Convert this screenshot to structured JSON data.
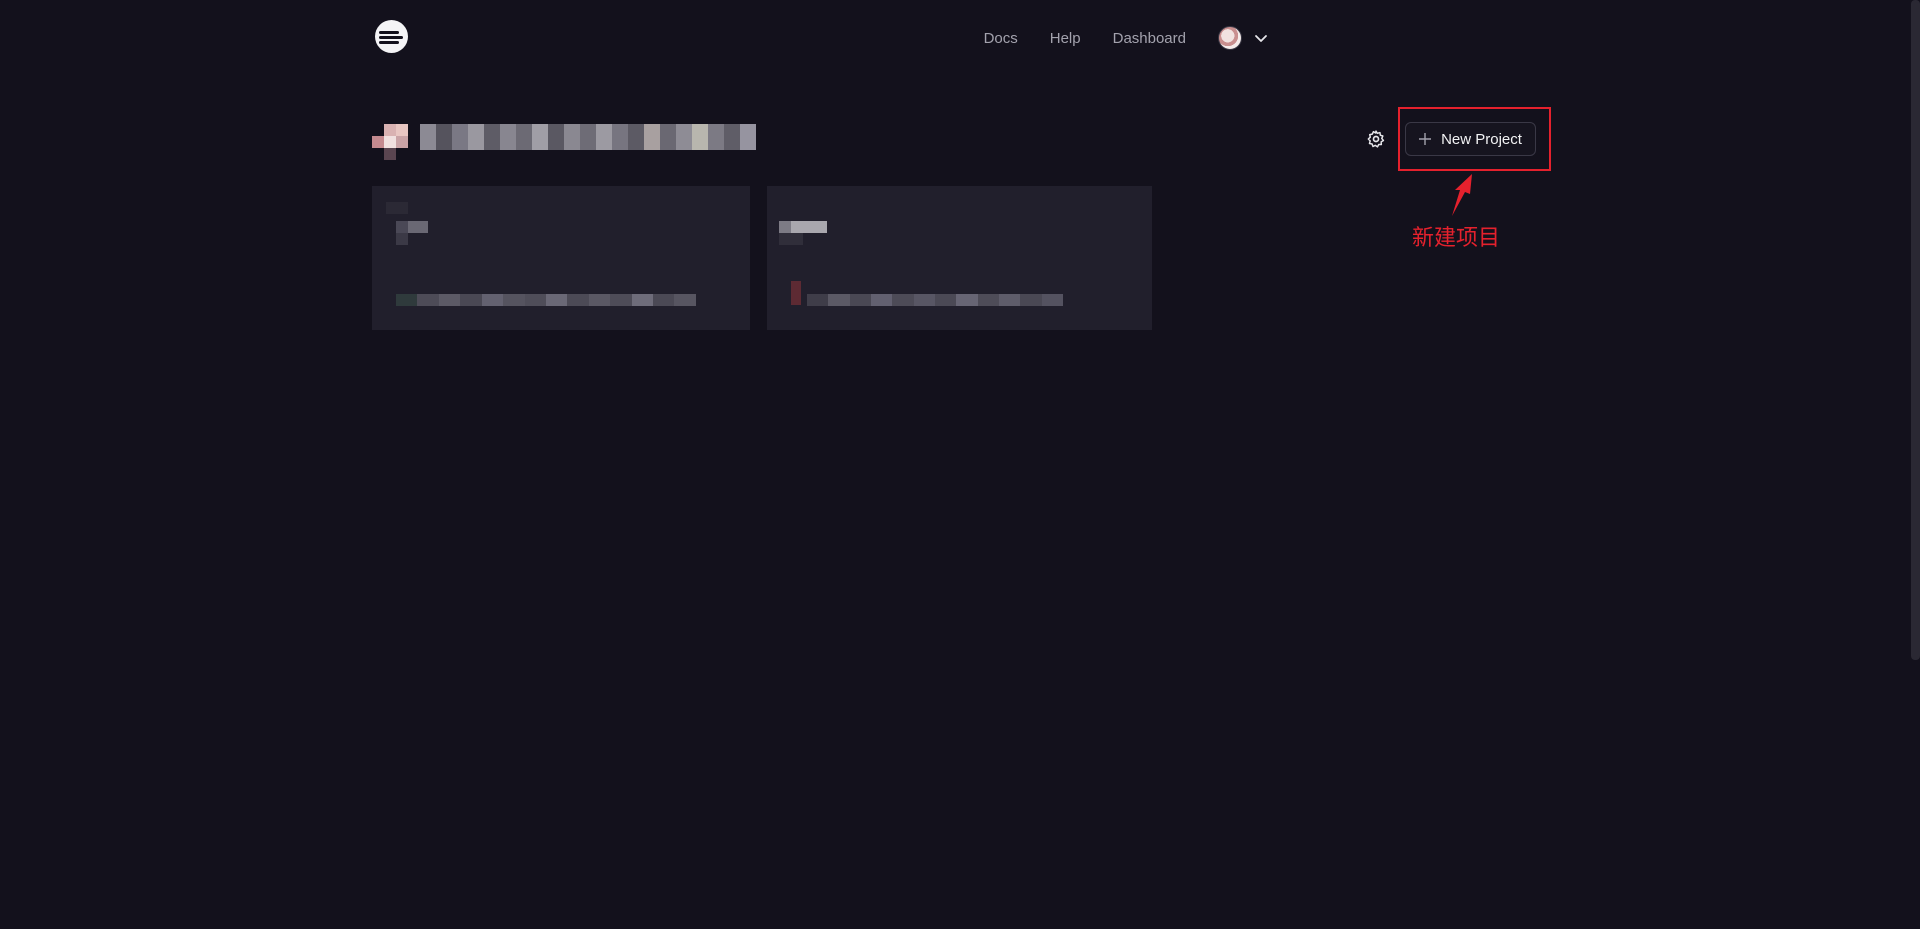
{
  "header": {
    "logo_icon": "app-logo-icon",
    "nav": [
      {
        "label": "Docs"
      },
      {
        "label": "Help"
      },
      {
        "label": "Dashboard"
      }
    ],
    "user_menu_icon": "chevron-down-icon"
  },
  "toolbar": {
    "settings_icon": "gear-icon",
    "new_project_label": "New Project",
    "new_project_icon": "plus-icon"
  },
  "annotation": {
    "label": "新建项目",
    "color": "#e5212d"
  },
  "colors": {
    "background": "#13111c",
    "card": "#211f2c",
    "text_muted": "#a3a2ad"
  }
}
